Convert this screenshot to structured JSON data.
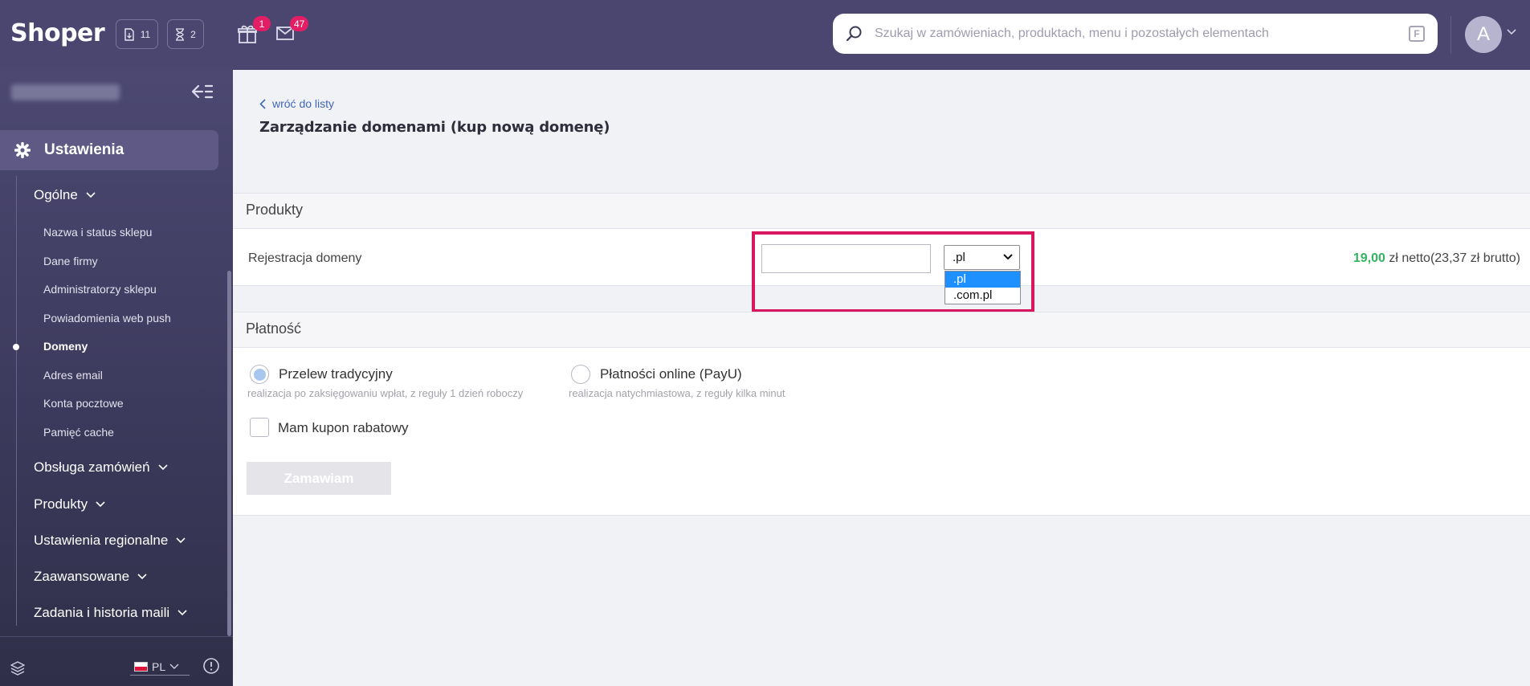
{
  "header": {
    "logo": "Shoper",
    "orders_count": "11",
    "pending_count": "2",
    "gifts_badge": "1",
    "messages_badge": "47",
    "search_placeholder": "Szukaj w zamówieniach, produktach, menu i pozostałych elementach",
    "search_shortcut": "F",
    "avatar_letter": "A",
    "accent_color": "#4a4670",
    "badge_color": "#e41e64"
  },
  "sidebar": {
    "shop_name": "blurred",
    "section_title": "Ustawienia",
    "groups": [
      {
        "label": "Ogólne"
      },
      {
        "label": "Obsługa zamówień"
      },
      {
        "label": "Produkty"
      },
      {
        "label": "Ustawienia regionalne"
      },
      {
        "label": "Zaawansowane"
      },
      {
        "label": "Zadania i historia maili"
      }
    ],
    "items": [
      {
        "label": "Nazwa i status sklepu"
      },
      {
        "label": "Dane firmy"
      },
      {
        "label": "Administratorzy sklepu"
      },
      {
        "label": "Powiadomienia web push"
      },
      {
        "label": "Domeny"
      },
      {
        "label": "Adres email"
      },
      {
        "label": "Konta pocztowe"
      },
      {
        "label": "Pamięć cache"
      }
    ],
    "language": "PL"
  },
  "main": {
    "back_label": "wróć do listy",
    "title": "Zarządzanie domenami (kup nową domenę)",
    "products": {
      "heading": "Produkty",
      "row_label": "Rejestracja domeny",
      "domain_value": "",
      "tld_selected": ".pl",
      "tld_options": [
        ".pl",
        ".com.pl"
      ],
      "price_net": "19,00",
      "price_rest": " zł netto(23,37 zł brutto)",
      "highlight_color": "#d8175e"
    },
    "payment": {
      "heading": "Płatność",
      "options": [
        {
          "label": "Przelew tradycyjny",
          "desc": "realizacja po zaksięgowaniu wpłat, z reguły 1 dzień roboczy"
        },
        {
          "label": "Płatności online (PayU)",
          "desc": "realizacja natychmiastowa, z reguły kilka minut"
        }
      ],
      "coupon_label": "Mam kupon rabatowy",
      "order_button": "Zamawiam"
    }
  }
}
